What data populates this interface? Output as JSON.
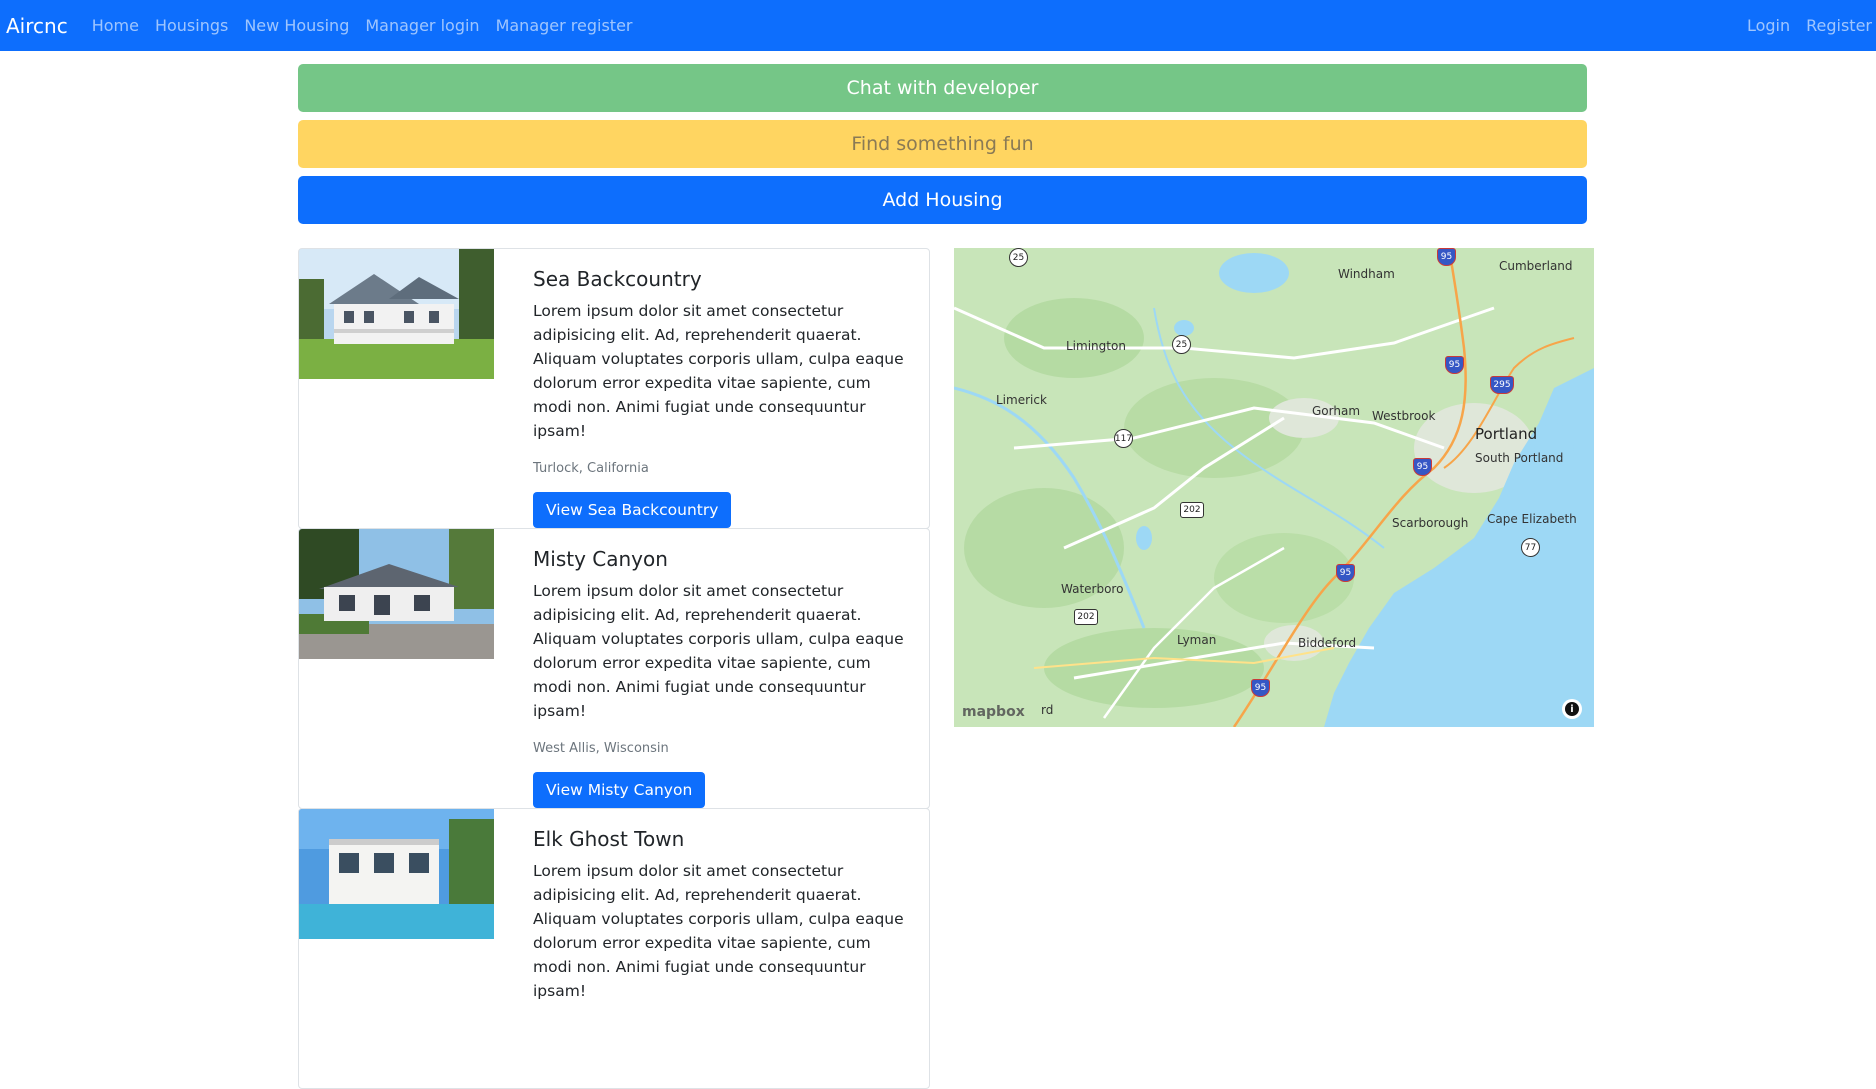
{
  "navbar": {
    "brand": "Aircnc",
    "links": [
      "Home",
      "Housings",
      "New Housing",
      "Manager login",
      "Manager register"
    ],
    "right_links": [
      "Login",
      "Register"
    ]
  },
  "actions": {
    "chat": "Chat with developer",
    "fun": "Find something fun",
    "add": "Add Housing"
  },
  "housings": [
    {
      "title": "Sea Backcountry",
      "description": "Lorem ipsum dolor sit amet consectetur adipisicing elit. Ad, reprehenderit quaerat. Aliquam voluptates corporis ullam, culpa eaque dolorum error expedita vitae sapiente, cum modi non. Animi fugiat unde consequuntur ipsam!",
      "location": "Turlock, California",
      "button": "View Sea Backcountry"
    },
    {
      "title": "Misty Canyon",
      "description": "Lorem ipsum dolor sit amet consectetur adipisicing elit. Ad, reprehenderit quaerat. Aliquam voluptates corporis ullam, culpa eaque dolorum error expedita vitae sapiente, cum modi non. Animi fugiat unde consequuntur ipsam!",
      "location": "West Allis, Wisconsin",
      "button": "View Misty Canyon"
    },
    {
      "title": "Elk Ghost Town",
      "description": "Lorem ipsum dolor sit amet consectetur adipisicing elit. Ad, reprehenderit quaerat. Aliquam voluptates corporis ullam, culpa eaque dolorum error expedita vitae sapiente, cum modi non. Animi fugiat unde consequuntur ipsam!",
      "location": "",
      "button": ""
    }
  ],
  "map": {
    "places": [
      "Windham",
      "Cumberland",
      "Limington",
      "Limerick",
      "Gorham",
      "Westbrook",
      "Portland",
      "South Portland",
      "Scarborough",
      "Cape Elizabeth",
      "Waterboro",
      "Lyman",
      "Biddeford",
      "rd"
    ],
    "shields": [
      "25",
      "25",
      "117",
      "202",
      "202",
      "77",
      "95",
      "95",
      "295",
      "95",
      "95",
      "95"
    ],
    "logo": "mapbox",
    "info_icon": "info-icon",
    "colors": {
      "land": "#c8e5b9",
      "water": "#9dd8f5",
      "highway": "#f7a54a"
    }
  }
}
